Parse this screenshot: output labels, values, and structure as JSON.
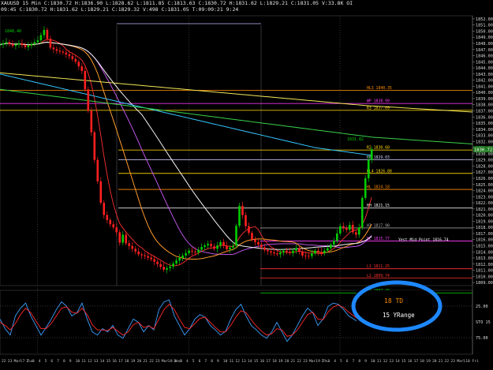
{
  "header": {
    "line1": "XAUUSD 15 Min  C:1830.72  H:1836.90  L:1828.62  L:1811.85  C:1813.63  C:1830.72  H:1831.62  L:1829.21  C:1831.05  V:33.8K  OI",
    "line2": "09:45  C:1830.72  H:1831.62  L:1829.21  C:1829.32  V:498  C:1831.05  T:09:09:21  9:24"
  },
  "colors": {
    "background": "#000000",
    "up_candle": "#00cc00",
    "down_candle": "#ff2020",
    "white_ma": "#f5f5f5",
    "orange_ma": "#ff9a2a",
    "red_ma": "#ff3030",
    "yellow_ma": "#f2e65a",
    "green_ma": "#39d24a",
    "cyan_ma": "#36c6ff",
    "magenta_ma": "#d15cff",
    "stoch_blue": "#3aa0ff",
    "stoch_red": "#ff2a2a",
    "circle": "#1e88ff"
  },
  "chart_data": [
    {
      "type": "line",
      "name": "price",
      "ylim": [
        1808.5,
        1852.5
      ],
      "y_ticks": [
        "1852.00",
        "1851.00",
        "1850.00",
        "1849.00",
        "1848.00",
        "1847.00",
        "1846.00",
        "1845.00",
        "1844.00",
        "1843.00",
        "1842.00",
        "1841.00",
        "1840.00",
        "1839.00",
        "1838.00",
        "1837.00",
        "1836.00",
        "1835.00",
        "1834.00",
        "1833.00",
        "1832.00",
        "1831.00",
        "1830.00",
        "1829.00",
        "1828.00",
        "1827.00",
        "1826.00",
        "1825.00",
        "1824.00",
        "1823.00",
        "1822.00",
        "1821.00",
        "1820.00",
        "1819.00",
        "1818.00",
        "1817.00",
        "1816.00",
        "1815.00",
        "1814.00",
        "1813.00",
        "1812.00",
        "1811.00",
        "1810.00",
        "1809.00"
      ],
      "last_price": "1830.72",
      "close_path": [
        [
          0,
          1847.8
        ],
        [
          2,
          1848.2
        ],
        [
          4,
          1847.6
        ],
        [
          6,
          1848.0
        ],
        [
          8,
          1847.4
        ],
        [
          10,
          1847.9
        ],
        [
          12,
          1848.5
        ],
        [
          14,
          1850.2
        ],
        [
          16,
          1847.3
        ],
        [
          18,
          1846.8
        ],
        [
          20,
          1846.5
        ],
        [
          22,
          1845.9
        ],
        [
          24,
          1845.0
        ],
        [
          26,
          1843.5
        ],
        [
          27,
          1840.5
        ],
        [
          28,
          1837.0
        ],
        [
          29,
          1833.5
        ],
        [
          30,
          1829.0
        ],
        [
          31,
          1825.5
        ],
        [
          32,
          1822.0
        ],
        [
          33,
          1820.0
        ],
        [
          34,
          1819.2
        ],
        [
          35,
          1818.5
        ],
        [
          36,
          1818.0
        ],
        [
          37,
          1817.2
        ],
        [
          38,
          1815.5
        ],
        [
          39,
          1816.8
        ],
        [
          40,
          1815.4
        ],
        [
          42,
          1814.5
        ],
        [
          44,
          1813.6
        ],
        [
          46,
          1813.3
        ],
        [
          48,
          1812.8
        ],
        [
          50,
          1812.0
        ],
        [
          52,
          1811.1
        ],
        [
          54,
          1811.6
        ],
        [
          56,
          1812.6
        ],
        [
          58,
          1813.4
        ],
        [
          60,
          1814.2
        ],
        [
          62,
          1813.9
        ],
        [
          64,
          1814.8
        ],
        [
          66,
          1815.3
        ],
        [
          68,
          1814.5
        ],
        [
          70,
          1815.6
        ],
        [
          72,
          1814.4
        ],
        [
          74,
          1815.0
        ],
        [
          76,
          1821.5
        ],
        [
          77,
          1820.0
        ],
        [
          78,
          1818.2
        ],
        [
          80,
          1816.0
        ],
        [
          82,
          1815.2
        ],
        [
          84,
          1814.3
        ],
        [
          86,
          1813.9
        ],
        [
          88,
          1813.6
        ],
        [
          90,
          1814.2
        ],
        [
          92,
          1813.8
        ],
        [
          94,
          1814.6
        ],
        [
          96,
          1813.4
        ],
        [
          98,
          1813.3
        ],
        [
          100,
          1814.2
        ],
        [
          102,
          1813.8
        ],
        [
          104,
          1814.6
        ],
        [
          106,
          1815.8
        ],
        [
          108,
          1818.2
        ],
        [
          110,
          1817.6
        ],
        [
          111,
          1818.4
        ],
        [
          112,
          1817.2
        ],
        [
          113,
          1816.8
        ],
        [
          114,
          1818.0
        ],
        [
          115,
          1822.8
        ],
        [
          116,
          1826.0
        ],
        [
          117,
          1829.0
        ],
        [
          118,
          1830.72
        ]
      ],
      "levels": [
        {
          "label": "HL3 1840.35",
          "value": 1840.35,
          "color": "#ff8c00"
        },
        {
          "label": "WP 1838.99",
          "value": 1838.2,
          "color": "#ff3cff"
        },
        {
          "label": "R3 1837.09",
          "value": 1837.09,
          "color": "#ffd700"
        },
        {
          "label": "R2 1830.60",
          "value": 1830.6,
          "color": "#ffd700"
        },
        {
          "label": "H6 1829.03",
          "value": 1829.03,
          "color": "#d0d0ff"
        },
        {
          "label": "HL4 1826.80",
          "value": 1826.8,
          "color": "#ffd700"
        },
        {
          "label": "HL 1824.18",
          "value": 1824.18,
          "color": "#ff8c00"
        },
        {
          "label": "HH 1821.15",
          "value": 1821.15,
          "color": "#ffffff"
        },
        {
          "label": "H3 1817.90",
          "value": 1817.9,
          "color": "#aaaaaa"
        },
        {
          "label": "HL 1815.77",
          "value": 1815.77,
          "color": "#ff3cff"
        },
        {
          "label": "L1 1811.25",
          "value": 1811.25,
          "color": "#ff3030"
        },
        {
          "label": "L2 1809.74",
          "value": 1809.74,
          "color": "#ff3030"
        },
        {
          "label": "L3 1807.30",
          "value": 1807.3,
          "color": "#00cc00"
        }
      ],
      "annotations": [
        "1848.40",
        "1831.82",
        "Yest Mid Point 1816.74",
        "18 TD",
        "15 YRange"
      ],
      "ma_lines": [
        "white_ma",
        "orange_ma",
        "red_ma",
        "yellow_ma",
        "green_ma",
        "cyan_ma",
        "magenta_ma"
      ],
      "x_labels": [
        "22",
        "23",
        "Mar 7 Tue",
        "1",
        "2",
        "3",
        "4",
        "5",
        "6",
        "7",
        "8",
        "9",
        "10",
        "11",
        "12",
        "13",
        "14",
        "15",
        "16",
        "17",
        "18",
        "19",
        "20",
        "21",
        "22",
        "23",
        "Mar 8 Wed",
        "1",
        "2",
        "3",
        "4",
        "5",
        "6",
        "7",
        "8",
        "9",
        "10",
        "11",
        "12",
        "13",
        "14",
        "15",
        "16",
        "17",
        "18",
        "19",
        "20",
        "21",
        "22",
        "23",
        "Mar 9 Thu",
        "1",
        "2",
        "3",
        "4",
        "5",
        "6",
        "7",
        "8",
        "9",
        "10",
        "11",
        "12",
        "13",
        "14",
        "15",
        "16",
        "17",
        "18",
        "19",
        "20",
        "21",
        "22",
        "23",
        "Mar 10 Fri",
        "1",
        "2",
        "3",
        "4"
      ]
    },
    {
      "type": "line",
      "name": "STO 15",
      "ylim": [
        0,
        100
      ],
      "y_ticks": [
        "25.00",
        "STO 15",
        "75.00"
      ],
      "series": [
        {
          "color": "stoch_blue",
          "values": [
            55,
            40,
            30,
            60,
            72,
            80,
            60,
            45,
            30,
            42,
            55,
            70,
            82,
            75,
            60,
            65,
            80,
            55,
            35,
            30,
            40,
            35,
            45,
            30,
            25,
            40,
            55,
            50,
            35,
            45,
            38,
            70,
            82,
            85,
            60,
            45,
            30,
            40,
            55,
            62,
            58,
            45,
            38,
            30,
            36,
            55,
            70,
            78,
            60,
            45,
            38,
            30,
            25,
            35,
            50,
            35,
            20,
            30,
            45,
            60,
            72,
            65,
            45,
            55,
            75,
            80,
            78,
            70,
            60,
            55,
            50
          ]
        },
        {
          "color": "stoch_red",
          "values": [
            50,
            45,
            38,
            48,
            62,
            72,
            65,
            52,
            40,
            40,
            48,
            60,
            72,
            74,
            66,
            64,
            72,
            62,
            46,
            38,
            38,
            37,
            42,
            36,
            30,
            35,
            46,
            50,
            42,
            44,
            40,
            55,
            70,
            78,
            70,
            55,
            42,
            40,
            48,
            56,
            58,
            50,
            42,
            35,
            35,
            45,
            58,
            68,
            65,
            54,
            44,
            36,
            30,
            32,
            40,
            38,
            28,
            30,
            38,
            50,
            62,
            66,
            55,
            54,
            66,
            74,
            77,
            73,
            66,
            60,
            54
          ]
        }
      ]
    }
  ]
}
